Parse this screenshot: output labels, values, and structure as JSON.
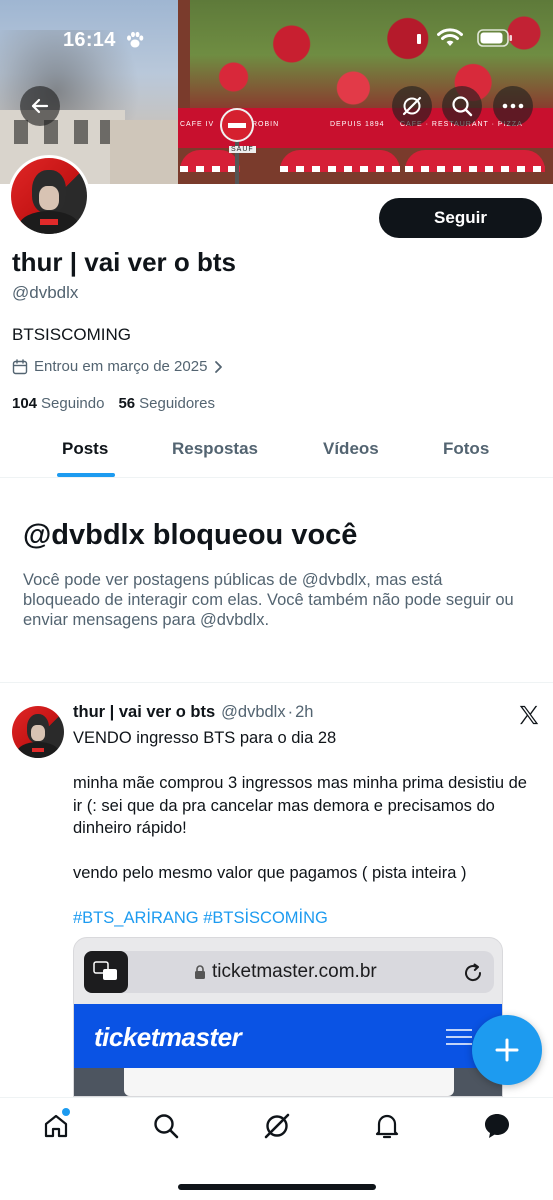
{
  "status_bar": {
    "time": "16:14"
  },
  "profile": {
    "display_name": "thur | vai ver o bts",
    "handle": "@dvbdlx",
    "bio": "BTSISCOMING",
    "joined": "Entrou em março de 2025",
    "following_count": "104",
    "following_label": "Seguindo",
    "followers_count": "56",
    "followers_label": "Seguidores",
    "follow_button": "Seguir"
  },
  "banner": {
    "awning_left": "DEPUIS 1894",
    "awning_right": "CAFE · RESTAURANT · PIZZA",
    "awning_far_left": "CAFE IV",
    "awning_center": "ROBIN",
    "sign_label": "SAUF"
  },
  "tabs": [
    {
      "label": "Posts",
      "active": true
    },
    {
      "label": "Respostas",
      "active": false
    },
    {
      "label": "Vídeos",
      "active": false
    },
    {
      "label": "Fotos",
      "active": false
    }
  ],
  "blocked": {
    "title": "@dvbdlx bloqueou você",
    "text": "Você pode ver postagens públicas de @dvbdlx, mas está bloqueado de interagir com elas. Você também não pode seguir ou enviar mensagens para @dvbdlx."
  },
  "post": {
    "author_name": "thur | vai ver o bts",
    "author_handle": "@dvbdlx",
    "separator": "·",
    "time_ago": "2h",
    "line1": "VENDO ingresso BTS para o dia 28",
    "line2": "minha mãe comprou 3 ingressos mas minha prima desistiu de ir (: sei que da pra cancelar mas demora e precisamos do dinheiro rápido!",
    "line3": "vendo pelo mesmo valor que pagamos ( pista inteira )",
    "hashtags": "#BTS_ARİRANG #BTSİSCOMİNG",
    "media": {
      "url": "ticketmaster.com.br",
      "brand": "ticketmaster"
    }
  },
  "colors": {
    "accent": "#1d9bf0",
    "text_primary": "#0f1419",
    "text_secondary": "#536471",
    "ticketmaster_blue": "#0a53e4"
  },
  "icons": {
    "back": "arrow-left-icon",
    "grok": "grok-icon",
    "search": "search-icon",
    "more": "more-icon",
    "calendar": "calendar-icon",
    "chevron": "chevron-right-icon",
    "x_logo": "x-logo-icon",
    "fab": "plus-icon",
    "nav": [
      "home-icon",
      "search-icon",
      "grok-icon",
      "bell-icon",
      "messages-icon"
    ]
  }
}
